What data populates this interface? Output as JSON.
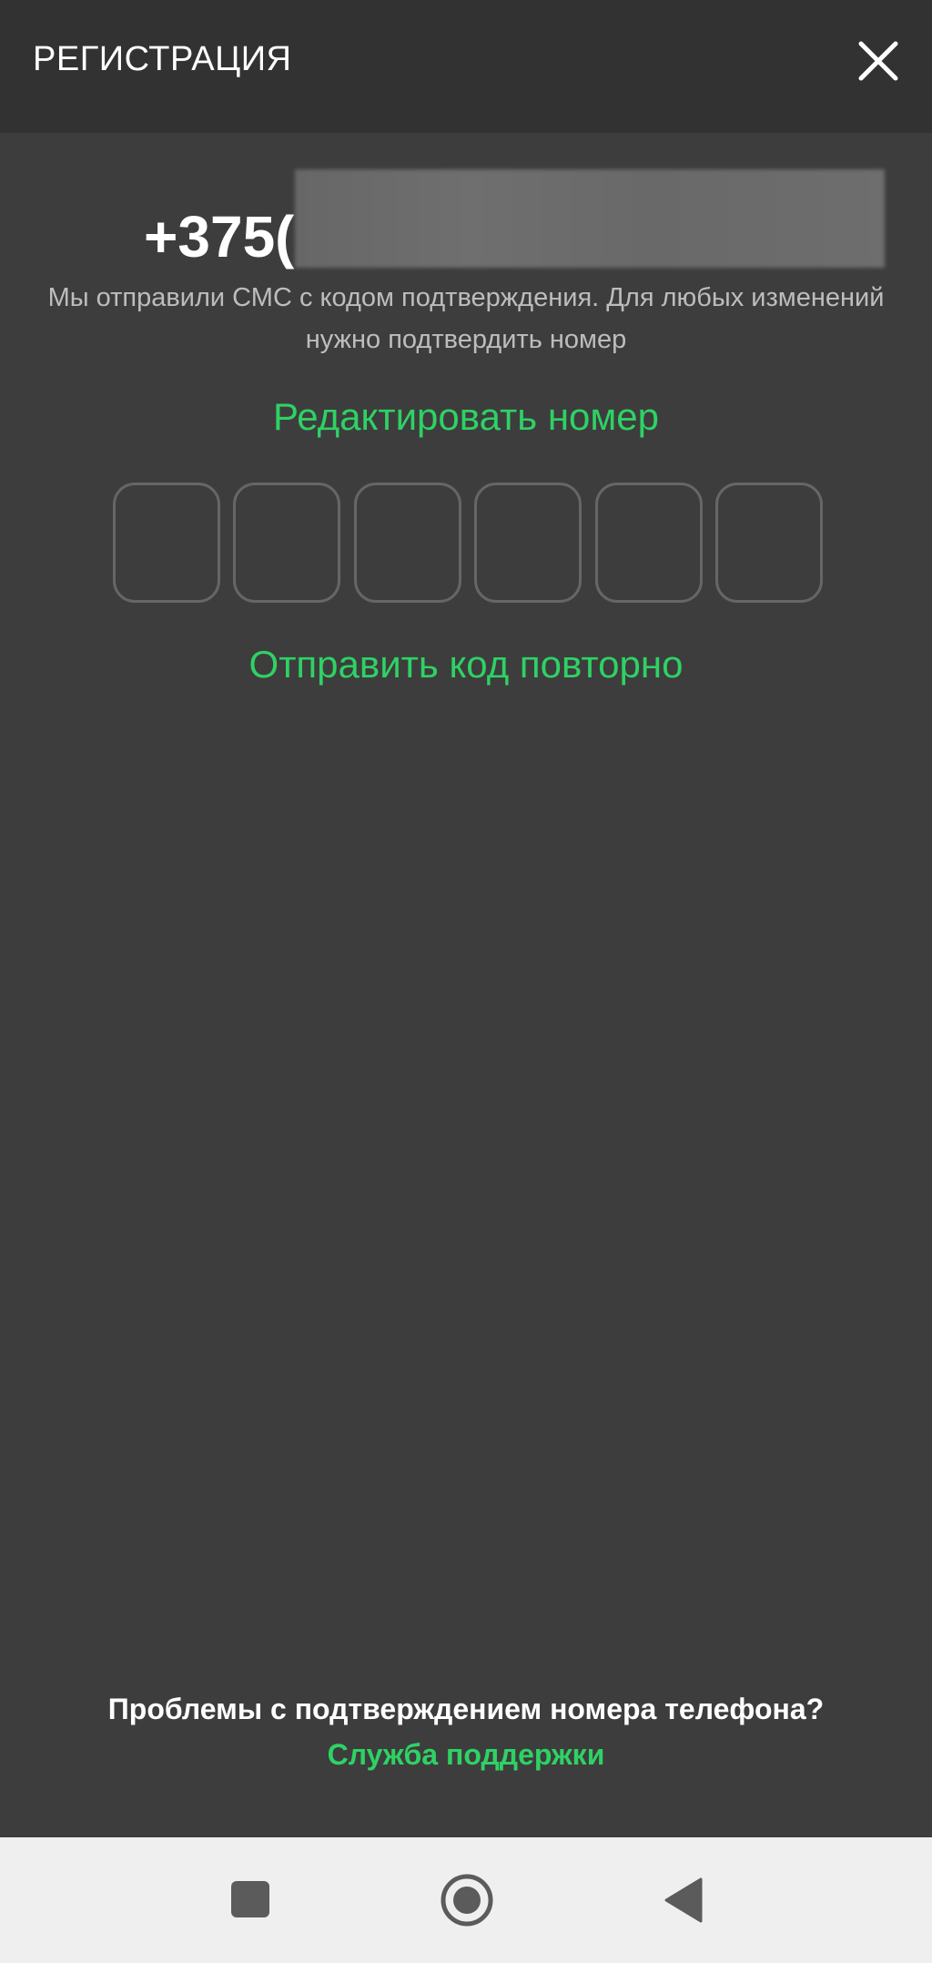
{
  "header": {
    "title": "РЕГИСТРАЦИЯ",
    "close_icon": "close-icon"
  },
  "phone": {
    "number_visible": "+375(",
    "redacted": true
  },
  "info": {
    "message": "Мы отправили СМС с кодом подтверждения. Для любых изменений нужно подтвердить номер"
  },
  "actions": {
    "edit_number": "Редактировать номер",
    "resend_code": "Отправить код повторно"
  },
  "code_input": {
    "length": 6,
    "values": [
      "",
      "",
      "",
      "",
      "",
      ""
    ]
  },
  "footer": {
    "problem_text": "Проблемы с подтверждением номера телефона?",
    "support_link": "Служба поддержки"
  },
  "navbar": {
    "icons": [
      "recents-square-icon",
      "home-circle-icon",
      "back-triangle-icon"
    ]
  },
  "colors": {
    "background": "#3d3d3d",
    "header_bg": "#323232",
    "accent": "#2ed264",
    "text": "#ffffff",
    "muted_text": "#bdbdbd",
    "cell_border": "#666666",
    "navbar_bg": "#efefef"
  }
}
